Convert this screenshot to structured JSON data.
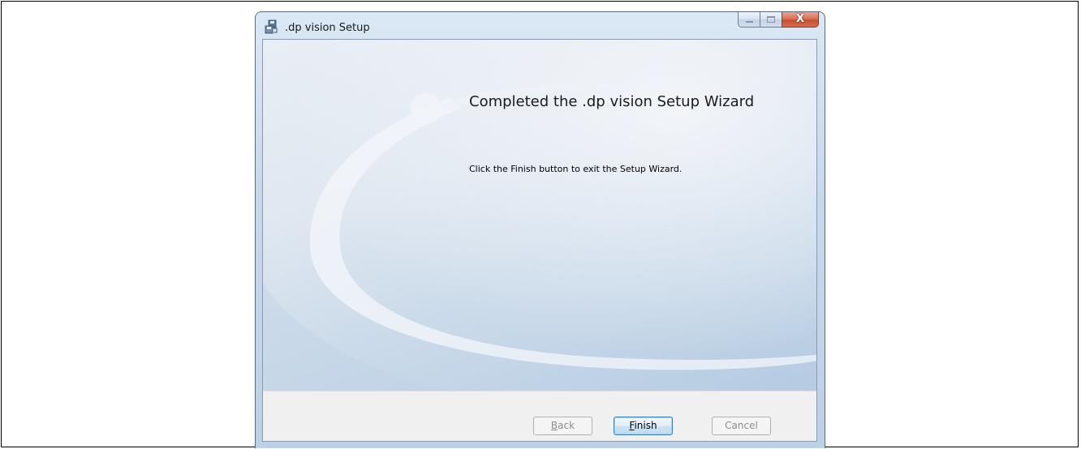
{
  "window": {
    "title": ".dp vision Setup",
    "app_icon": "installer-icon"
  },
  "caption_buttons": {
    "minimize_icon": "minimize-icon",
    "maximize_icon": "maximize-icon",
    "close_icon": "close-icon",
    "close_glyph": "X"
  },
  "wizard": {
    "heading": "Completed the .dp vision Setup Wizard",
    "body": "Click the Finish button to exit the Setup Wizard."
  },
  "buttons": {
    "back": {
      "mnemonic": "B",
      "rest": "ack",
      "enabled": false
    },
    "finish": {
      "mnemonic": "F",
      "rest": "inish",
      "enabled": true,
      "default": true
    },
    "cancel": {
      "label": "Cancel",
      "enabled": false
    }
  },
  "colors": {
    "banner_light": "#e9eef5",
    "banner_dark": "#b5cbe2",
    "default_button_border": "#3c7fb1",
    "close_button": "#c74f30"
  }
}
